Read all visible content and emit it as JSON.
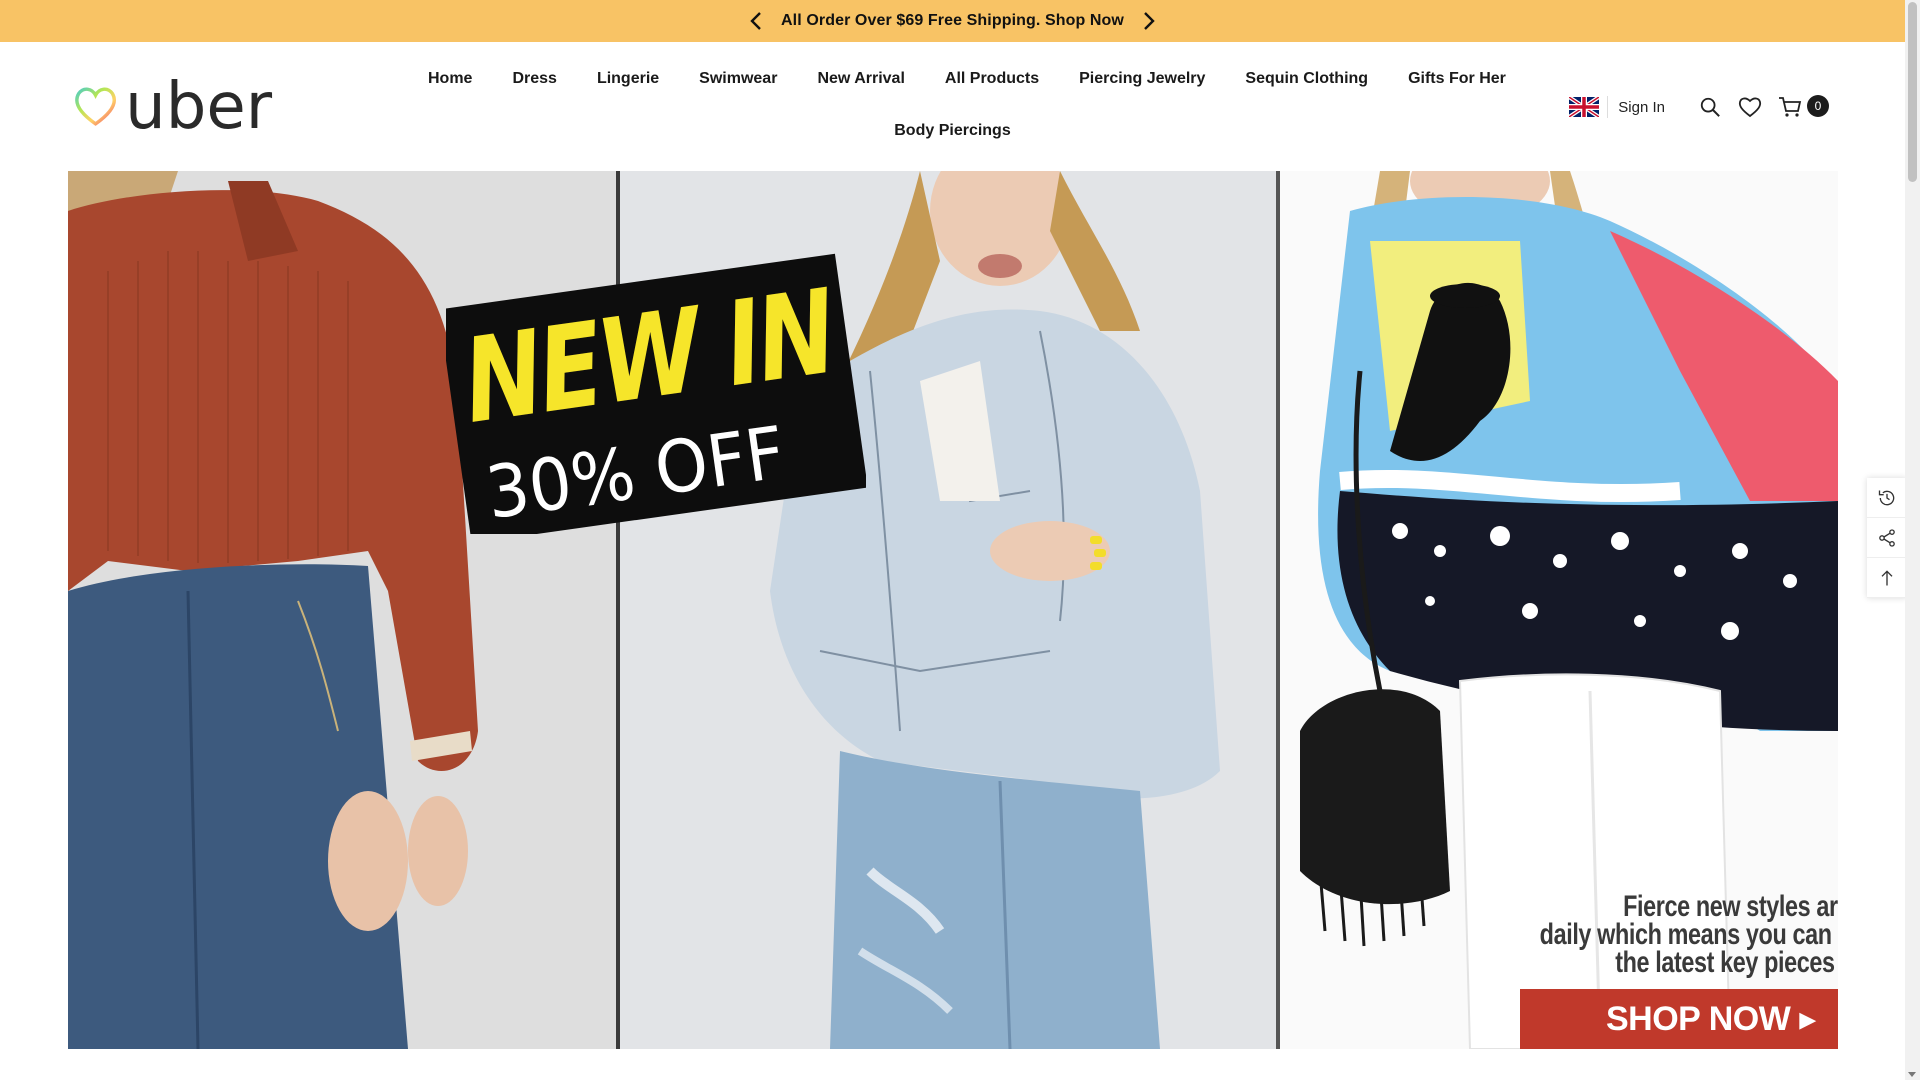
{
  "announcement": {
    "text": "All Order Over $69 Free Shipping. Shop Now",
    "prev_icon": "chevron-left-icon",
    "next_icon": "chevron-right-icon",
    "bg_color": "#f8c365"
  },
  "header": {
    "logo_text": "uber",
    "nav": [
      "Home",
      "Dress",
      "Lingerie",
      "Swimwear",
      "New Arrival",
      "All Products",
      "Piercing Jewelry",
      "Sequin Clothing",
      "Gifts For Her"
    ],
    "nav_row2": [
      "Body Piercings"
    ],
    "tools": {
      "flag_icon": "uk-flag-icon",
      "sign_in": "Sign In",
      "search_icon": "search-icon",
      "wishlist_icon": "heart-icon",
      "cart_icon": "cart-icon",
      "cart_count": "0"
    }
  },
  "banner": {
    "badge_line1": "NEW IN",
    "badge_line2": "30% OFF",
    "promo_line1": "Fierce new styles are ad",
    "promo_line2": "daily which means you can pick",
    "promo_line3": "the latest key pieces for i",
    "cta": "SHOP NOW ▸",
    "cta_color": "#c0392b"
  },
  "side_tools": {
    "recent_icon": "history-icon",
    "share_icon": "share-icon",
    "top_icon": "arrow-up-icon"
  }
}
